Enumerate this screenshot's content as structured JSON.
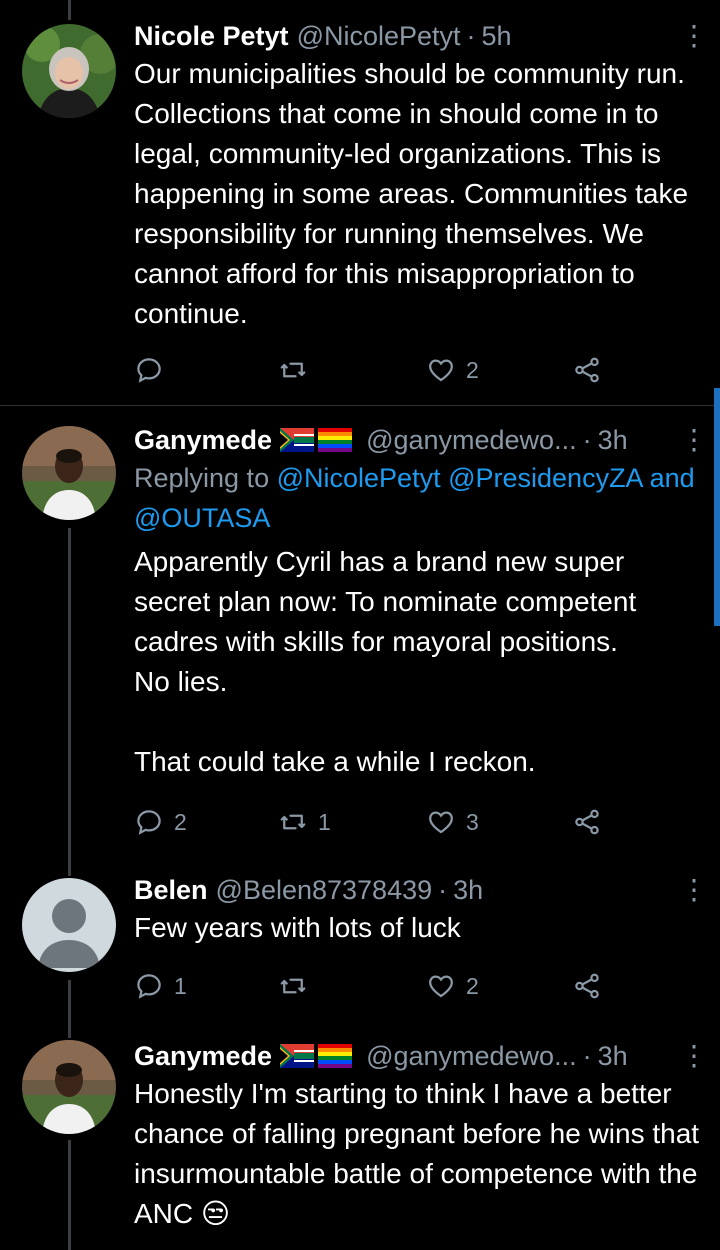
{
  "tweets": [
    {
      "name": "Nicole Petyt",
      "handle": "@NicolePetyt",
      "sep": "·",
      "time": "5h",
      "text": "Our municipalities should be community run. Collections that come in should come in to legal, community-led organizations. This is happening in some areas. Communities take responsibility for running themselves. We cannot afford for this misappropriation to continue.",
      "replies": "",
      "retweets": "",
      "likes": "2",
      "avatar_icon": "avatar-photo-woman"
    },
    {
      "name": "Ganymede",
      "handle": "@ganymedewo...",
      "sep": "·",
      "time": "3h",
      "replying_prefix": "Replying to",
      "replying_mention1": "@NicolePetyt",
      "replying_mention2": "@PresidencyZA",
      "replying_and": "and",
      "replying_mention3": "@OUTASA",
      "text": "Apparently Cyril has a brand new super secret plan now: To nominate competent cadres with skills for mayoral positions.\nNo lies.\n\nThat could take a while I reckon.",
      "replies": "2",
      "retweets": "1",
      "likes": "3",
      "avatar_icon": "avatar-photo-man"
    },
    {
      "name": "Belen",
      "handle": "@Belen87378439",
      "sep": "·",
      "time": "3h",
      "text": "Few years with lots of luck",
      "replies": "1",
      "retweets": "",
      "likes": "2",
      "avatar_icon": "default-avatar"
    },
    {
      "name": "Ganymede",
      "handle": "@ganymedewo...",
      "sep": "·",
      "time": "3h",
      "text": "Honestly I'm starting to think I have a better chance of falling pregnant before he wins that insurmountable battle of competence with the ANC 😒",
      "avatar_icon": "avatar-photo-man"
    }
  ],
  "colors": {
    "background": "#000000",
    "secondary_text": "#8b98a5",
    "link": "#1d9bf0",
    "divider": "#2f3336"
  }
}
